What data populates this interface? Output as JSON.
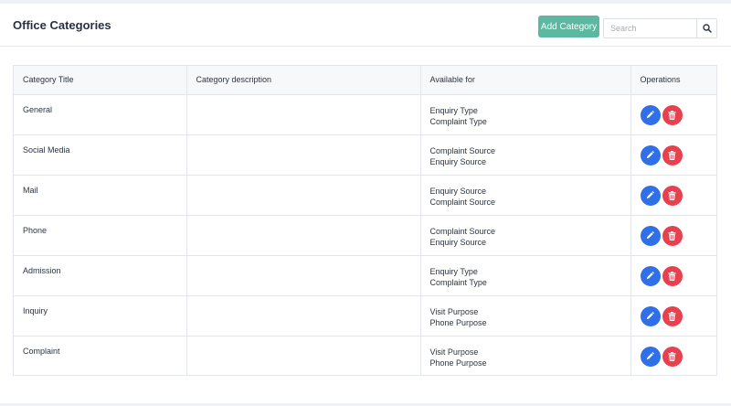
{
  "header": {
    "title": "Office Categories",
    "add_button_label": "Add Category",
    "search_placeholder": "Search",
    "search_value": ""
  },
  "colors": {
    "add_button": "#5cb8a0",
    "edit_button": "#2f6fe8",
    "delete_button": "#e8404f"
  },
  "icons": {
    "search": "search-icon",
    "edit": "pencil-icon",
    "delete": "trash-icon"
  },
  "table": {
    "columns": [
      "Category Title",
      "Category description",
      "Available for",
      "Operations"
    ],
    "rows": [
      {
        "title": "General",
        "description": "",
        "available_for": [
          "Enquiry Type",
          "Complaint Type"
        ]
      },
      {
        "title": "Social Media",
        "description": "",
        "available_for": [
          "Complaint Source",
          "Enquiry Source"
        ]
      },
      {
        "title": "Mail",
        "description": "",
        "available_for": [
          "Enquiry Source",
          "Complaint Source"
        ]
      },
      {
        "title": "Phone",
        "description": "",
        "available_for": [
          "Complaint Source",
          "Enquiry Source"
        ]
      },
      {
        "title": "Admission",
        "description": "",
        "available_for": [
          "Enquiry Type",
          "Complaint Type"
        ]
      },
      {
        "title": "Inquiry",
        "description": "",
        "available_for": [
          "Visit Purpose",
          "Phone Purpose"
        ]
      },
      {
        "title": "Complaint",
        "description": "",
        "available_for": [
          "Visit Purpose",
          "Phone Purpose"
        ]
      }
    ]
  }
}
